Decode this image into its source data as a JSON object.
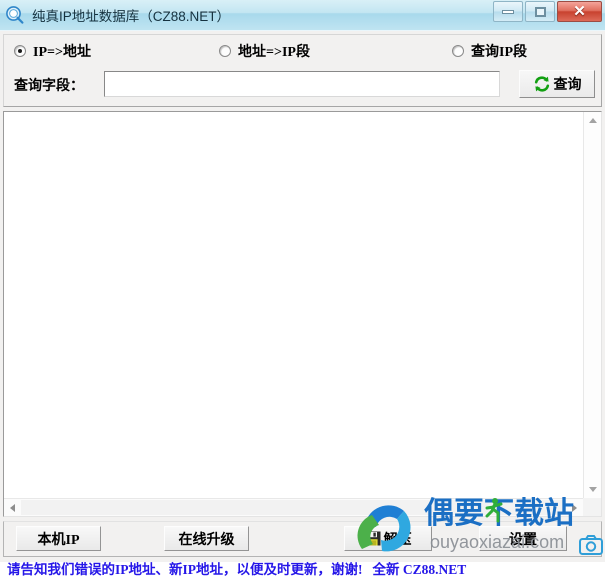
{
  "window": {
    "title": "纯真IP地址数据库（CZ88.NET）",
    "app_icon": "magnifier-icon",
    "controls": {
      "minimize": "minimize-icon",
      "maximize": "maximize-icon",
      "close": "✕"
    }
  },
  "query_mode": {
    "options": [
      {
        "label": "IP=>地址",
        "checked": true
      },
      {
        "label": "地址=>IP段",
        "checked": false
      },
      {
        "label": "查询IP段",
        "checked": false
      }
    ]
  },
  "search": {
    "label": "查询字段：",
    "value": "",
    "placeholder": "",
    "button_label": "查询",
    "button_icon": "refresh-icon"
  },
  "results": {
    "rows": [],
    "scroll": {
      "vertical_up": "▲",
      "vertical_down": "▼",
      "horizontal_left": "◀",
      "horizontal_right": "▶"
    }
  },
  "toolbar": {
    "buttons": [
      {
        "label": "本机IP",
        "icon": ""
      },
      {
        "label": "在线升级",
        "icon": ""
      },
      {
        "label": "解压",
        "icon": "save-disk-icon"
      },
      {
        "label": "设置",
        "icon": ""
      }
    ]
  },
  "status": {
    "message": "请告知我们错误的IP地址、新IP地址，以便及时更新，谢谢!",
    "secondary": "全新 CZ88.NET",
    "color": "#2516e8"
  },
  "watermark": {
    "site_name": "偶要下载站",
    "url": "ouyaoxiazai.com",
    "logo_icon": "swoosh-logo-icon",
    "runner_icon": "running-man-icon",
    "camera_icon": "camera-icon",
    "brand_color": "#1b6fc4",
    "accent_color": "#3fae45"
  }
}
